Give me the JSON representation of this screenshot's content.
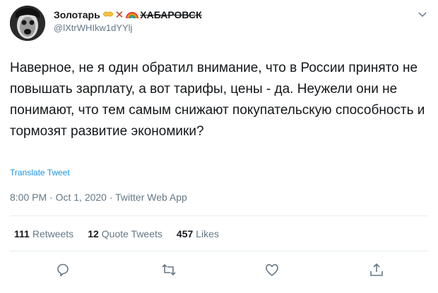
{
  "author": {
    "display_name": "Золотарь",
    "city": "ХАБАРОВСК",
    "handle": "@lXtrWHIkw1dYYlj",
    "emoji_names": [
      "handshake",
      "cross-mark",
      "rainbow"
    ]
  },
  "tweet": {
    "text": "Наверное, не я один обратил внимание, что в России принято не повышать зарплату, а вот тарифы, цены - да. Неужели они не понимают, что тем самым снижают покупательскую способность и тормозят развитие экономики?",
    "translate_label": "Translate Tweet",
    "timestamp": "8:00 PM · Oct 1, 2020 · Twitter Web App"
  },
  "stats": {
    "retweets_count": "111",
    "retweets_label": "Retweets",
    "quote_count": "12",
    "quote_label": "Quote Tweets",
    "likes_count": "457",
    "likes_label": "Likes"
  },
  "icons": {
    "reply": "reply-icon",
    "retweet": "retweet-icon",
    "like": "heart-icon",
    "share": "share-icon",
    "menu": "chevron-down-icon"
  },
  "colors": {
    "link": "#1b95e0",
    "secondary": "#657786",
    "primary_text": "#14171a"
  }
}
